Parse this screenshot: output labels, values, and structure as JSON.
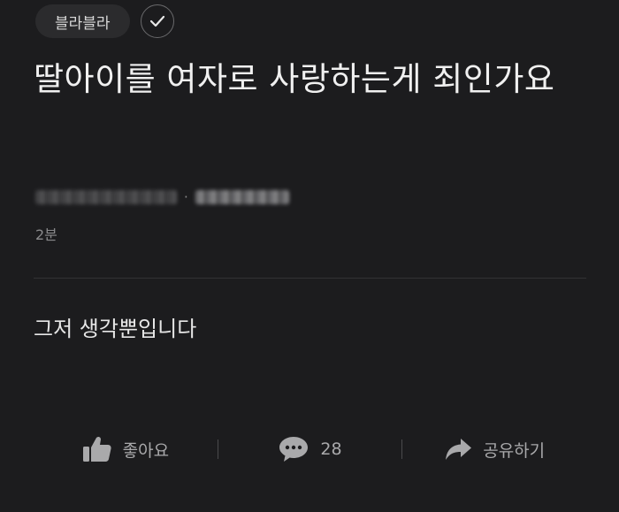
{
  "header": {
    "category_chip": "블라블라",
    "check_icon": "check-icon"
  },
  "post": {
    "title": "딸아이를 여자로 사랑하는게 죄인가요",
    "author_company": "",
    "author_nick": "",
    "time_ago": "2분",
    "body": "그저 생각뿐입니다"
  },
  "actions": {
    "like_label": "좋아요",
    "comment_count": "28",
    "share_label": "공유하기",
    "like_icon": "thumbs-up-icon",
    "comment_icon": "comment-bubble-icon",
    "share_icon": "share-arrow-icon"
  },
  "colors": {
    "background": "#1c1c1e",
    "text_primary": "#f0f0f0",
    "text_secondary": "#8a8a8c",
    "chip_background": "#2b2b2d",
    "icon": "#a9a9ab"
  }
}
